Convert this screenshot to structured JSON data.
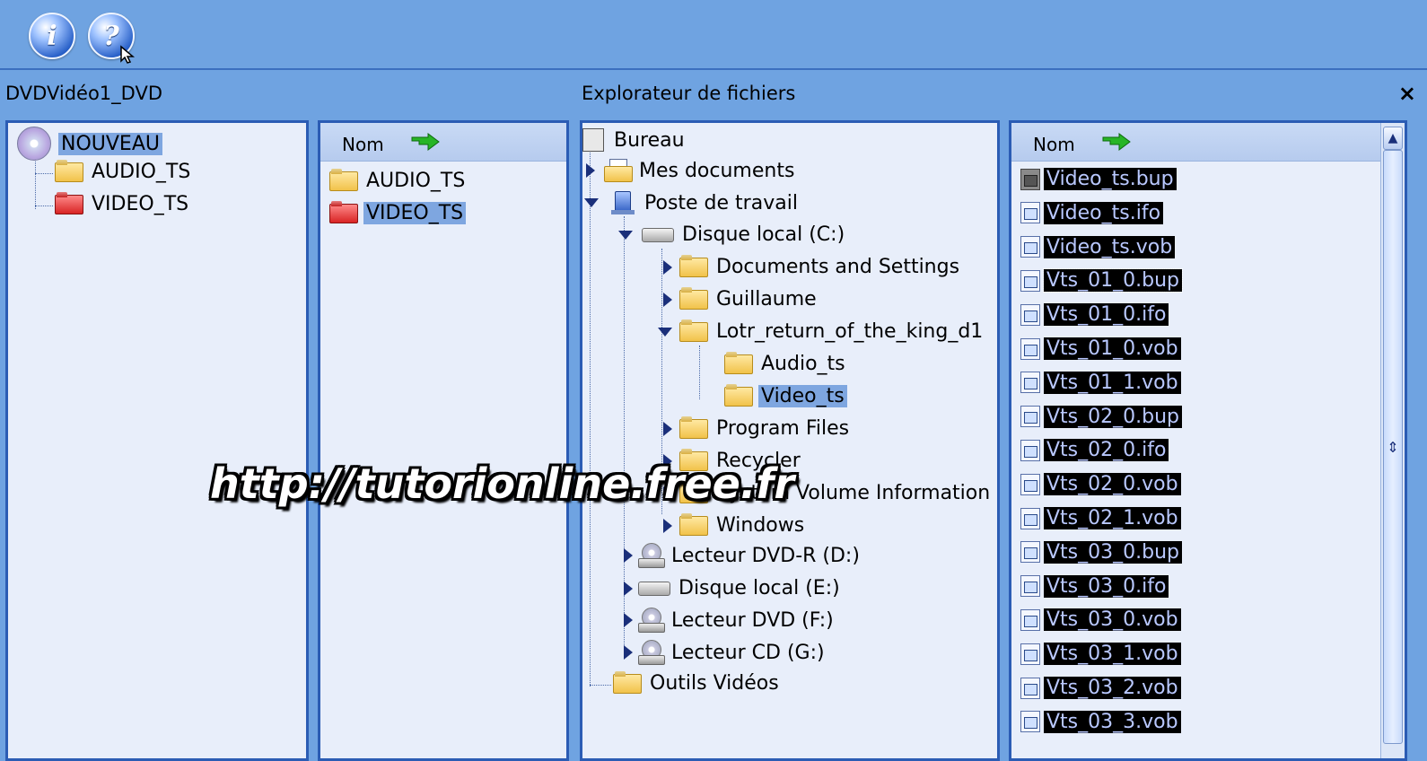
{
  "toolbar": {
    "info_button": "i",
    "help_button": "?"
  },
  "project_panel": {
    "title": "DVDVidéo1_DVD",
    "tree": [
      {
        "label": "NOUVEAU",
        "icon": "dvd-disc-icon",
        "selected": true
      },
      {
        "label": "AUDIO_TS",
        "icon": "yellow-folder-icon"
      },
      {
        "label": "VIDEO_TS",
        "icon": "red-folder-icon"
      }
    ]
  },
  "project_list": {
    "column": "Nom",
    "items": [
      {
        "label": "AUDIO_TS",
        "icon": "yellow-folder-icon"
      },
      {
        "label": "VIDEO_TS",
        "icon": "red-folder-icon",
        "selected": true
      }
    ]
  },
  "explorer": {
    "title": "Explorateur de fichiers",
    "close": "×",
    "tree": [
      {
        "label": "Bureau"
      },
      {
        "label": "Mes documents"
      },
      {
        "label": "Poste de travail"
      },
      {
        "label": "Disque local (C:)"
      },
      {
        "label": "Documents and Settings"
      },
      {
        "label": "Guillaume"
      },
      {
        "label": "Lotr_return_of_the_king_d1"
      },
      {
        "label": "Audio_ts"
      },
      {
        "label": "Video_ts",
        "selected": true
      },
      {
        "label": "Program Files"
      },
      {
        "label": "Recycler"
      },
      {
        "label": "System Volume Information"
      },
      {
        "label": "Windows"
      },
      {
        "label": "Lecteur DVD-R (D:)"
      },
      {
        "label": "Disque local (E:)"
      },
      {
        "label": "Lecteur DVD (F:)"
      },
      {
        "label": "Lecteur CD (G:)"
      },
      {
        "label": "Outils Vidéos"
      }
    ]
  },
  "file_list": {
    "column": "Nom",
    "files": [
      "Video_ts.bup",
      "Video_ts.ifo",
      "Video_ts.vob",
      "Vts_01_0.bup",
      "Vts_01_0.ifo",
      "Vts_01_0.vob",
      "Vts_01_1.vob",
      "Vts_02_0.bup",
      "Vts_02_0.ifo",
      "Vts_02_0.vob",
      "Vts_02_1.vob",
      "Vts_03_0.bup",
      "Vts_03_0.ifo",
      "Vts_03_0.vob",
      "Vts_03_1.vob",
      "Vts_03_2.vob",
      "Vts_03_3.vob"
    ]
  },
  "watermark": "http://tutorionline.free.fr",
  "colors": {
    "background": "#6fa3e1",
    "panel": "#e8eefa",
    "panel_border": "#2b5cb4",
    "selection": "#7ea6e0",
    "file_selection": "#000000"
  }
}
